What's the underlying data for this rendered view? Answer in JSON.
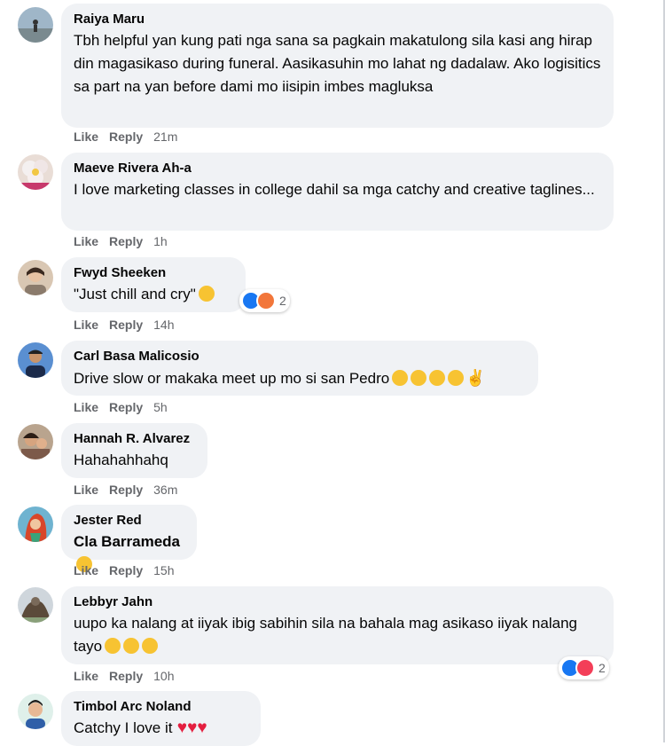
{
  "comments": [
    {
      "author": "Raiya Maru",
      "text": "Tbh helpful yan kung pati nga sana sa pagkain makatulong sila kasi ang hirap din magasikaso during funeral. Aasikasuhin mo lahat ng dadalaw. Ako logisitics sa part na yan before dami mo iisipin imbes magluksa",
      "time": "21m"
    },
    {
      "author": "Maeve Rivera Ah-a",
      "text": "I love marketing classes in college dahil sa mga catchy and creative taglines...",
      "time": "1h"
    },
    {
      "author": "Fwyd Sheeken",
      "text": "\"Just chill and cry\"",
      "time": "14h",
      "reaction_count": "2"
    },
    {
      "author": "Carl Basa Malicosio",
      "text": "Drive slow or makaka meet up mo si san Pedro",
      "time": "5h"
    },
    {
      "author": "Hannah R. Alvarez",
      "text": "Hahahahhahq",
      "time": "36m"
    },
    {
      "author": "Jester Red",
      "text": "Cla Barrameda",
      "time": "15h"
    },
    {
      "author": "Lebbyr Jahn",
      "text": "uupo ka nalang at iiyak ibig sabihin sila na bahala mag asikaso iiyak nalang tayo",
      "time": "10h",
      "reaction_count": "2"
    },
    {
      "author": "Timbol Arc Noland",
      "text": "Catchy I love it"
    }
  ],
  "actions": {
    "like": "Like",
    "reply": "Reply"
  },
  "colors": {
    "bubble": "#f0f2f5",
    "action_text": "#65676b",
    "like_blue": "#1877f2",
    "love_red": "#f33e58"
  }
}
